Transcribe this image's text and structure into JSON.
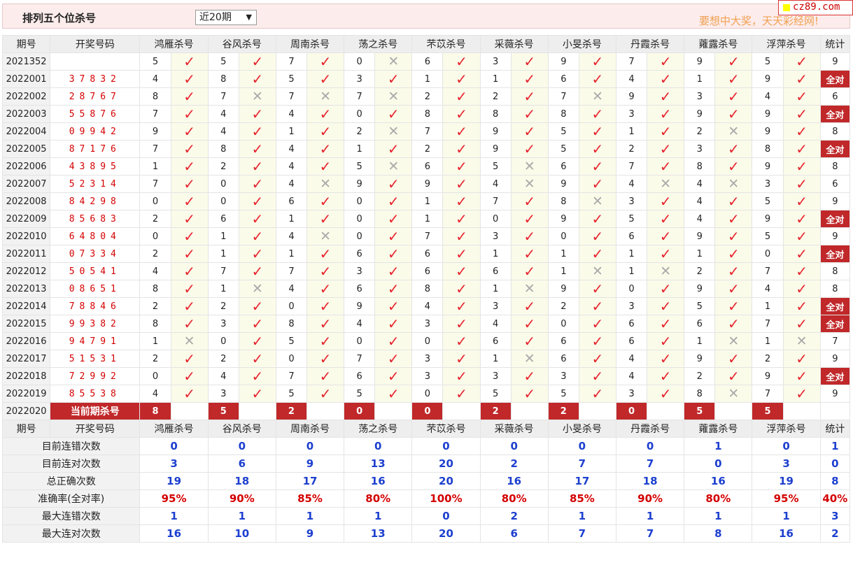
{
  "page": {
    "title": "排列五个位杀号",
    "period_selected": "近20期",
    "period_arrow": "▼",
    "slogan": "要想中大奖，天天彩经网!",
    "logo_text": "cz89.com"
  },
  "colors": {
    "accent_red": "#c0282a",
    "check_red": "#e6242d",
    "stat_blue": "#1c3fcf"
  },
  "table": {
    "headers": [
      "期号",
      "开奖号码",
      "鸿雁杀号",
      "谷风杀号",
      "周南杀号",
      "荡之杀号",
      "芣苡杀号",
      "采薇杀号",
      "小旻杀号",
      "丹霞杀号",
      "蕹露杀号",
      "浮萍杀号",
      "统计"
    ],
    "rows": [
      {
        "issue": "2021352",
        "draw": "",
        "kills": [
          5,
          5,
          7,
          0,
          6,
          3,
          9,
          7,
          9,
          5
        ],
        "marks": [
          "ok",
          "ok",
          "ok",
          "no",
          "ok",
          "ok",
          "ok",
          "ok",
          "ok",
          "ok"
        ],
        "stat": "9",
        "all": false
      },
      {
        "issue": "2022001",
        "draw": "37832",
        "kills": [
          4,
          8,
          5,
          3,
          1,
          1,
          6,
          4,
          1,
          9
        ],
        "marks": [
          "ok",
          "ok",
          "ok",
          "ok",
          "ok",
          "ok",
          "ok",
          "ok",
          "ok",
          "ok"
        ],
        "stat": "全对",
        "all": true
      },
      {
        "issue": "2022002",
        "draw": "28767",
        "kills": [
          8,
          7,
          7,
          7,
          2,
          2,
          7,
          9,
          3,
          4
        ],
        "marks": [
          "ok",
          "no",
          "no",
          "no",
          "ok",
          "ok",
          "no",
          "ok",
          "ok",
          "ok"
        ],
        "stat": "6",
        "all": false
      },
      {
        "issue": "2022003",
        "draw": "55876",
        "kills": [
          7,
          4,
          4,
          0,
          8,
          8,
          8,
          3,
          9,
          9
        ],
        "marks": [
          "ok",
          "ok",
          "ok",
          "ok",
          "ok",
          "ok",
          "ok",
          "ok",
          "ok",
          "ok"
        ],
        "stat": "全对",
        "all": true
      },
      {
        "issue": "2022004",
        "draw": "09942",
        "kills": [
          9,
          4,
          1,
          2,
          7,
          9,
          5,
          1,
          2,
          9
        ],
        "marks": [
          "ok",
          "ok",
          "ok",
          "no",
          "ok",
          "ok",
          "ok",
          "ok",
          "no",
          "ok"
        ],
        "stat": "8",
        "all": false
      },
      {
        "issue": "2022005",
        "draw": "87176",
        "kills": [
          7,
          8,
          4,
          1,
          2,
          9,
          5,
          2,
          3,
          8
        ],
        "marks": [
          "ok",
          "ok",
          "ok",
          "ok",
          "ok",
          "ok",
          "ok",
          "ok",
          "ok",
          "ok"
        ],
        "stat": "全对",
        "all": true
      },
      {
        "issue": "2022006",
        "draw": "43895",
        "kills": [
          1,
          2,
          4,
          5,
          6,
          5,
          6,
          7,
          8,
          9
        ],
        "marks": [
          "ok",
          "ok",
          "ok",
          "no",
          "ok",
          "no",
          "ok",
          "ok",
          "ok",
          "ok"
        ],
        "stat": "8",
        "all": false
      },
      {
        "issue": "2022007",
        "draw": "52314",
        "kills": [
          7,
          0,
          4,
          9,
          9,
          4,
          9,
          4,
          4,
          3
        ],
        "marks": [
          "ok",
          "ok",
          "no",
          "ok",
          "ok",
          "no",
          "ok",
          "no",
          "no",
          "ok"
        ],
        "stat": "6",
        "all": false
      },
      {
        "issue": "2022008",
        "draw": "84298",
        "kills": [
          0,
          0,
          6,
          0,
          1,
          7,
          8,
          3,
          4,
          5
        ],
        "marks": [
          "ok",
          "ok",
          "ok",
          "ok",
          "ok",
          "ok",
          "no",
          "ok",
          "ok",
          "ok"
        ],
        "stat": "9",
        "all": false
      },
      {
        "issue": "2022009",
        "draw": "85683",
        "kills": [
          2,
          6,
          1,
          0,
          1,
          0,
          9,
          5,
          4,
          9
        ],
        "marks": [
          "ok",
          "ok",
          "ok",
          "ok",
          "ok",
          "ok",
          "ok",
          "ok",
          "ok",
          "ok"
        ],
        "stat": "全对",
        "all": true
      },
      {
        "issue": "2022010",
        "draw": "64804",
        "kills": [
          0,
          1,
          4,
          0,
          7,
          3,
          0,
          6,
          9,
          5
        ],
        "marks": [
          "ok",
          "ok",
          "no",
          "ok",
          "ok",
          "ok",
          "ok",
          "ok",
          "ok",
          "ok"
        ],
        "stat": "9",
        "all": false
      },
      {
        "issue": "2022011",
        "draw": "07334",
        "kills": [
          2,
          1,
          1,
          6,
          6,
          1,
          1,
          1,
          1,
          0
        ],
        "marks": [
          "ok",
          "ok",
          "ok",
          "ok",
          "ok",
          "ok",
          "ok",
          "ok",
          "ok",
          "ok"
        ],
        "stat": "全对",
        "all": true
      },
      {
        "issue": "2022012",
        "draw": "50541",
        "kills": [
          4,
          7,
          7,
          3,
          6,
          6,
          1,
          1,
          2,
          7
        ],
        "marks": [
          "ok",
          "ok",
          "ok",
          "ok",
          "ok",
          "ok",
          "no",
          "no",
          "ok",
          "ok"
        ],
        "stat": "8",
        "all": false
      },
      {
        "issue": "2022013",
        "draw": "08651",
        "kills": [
          8,
          1,
          4,
          6,
          8,
          1,
          9,
          0,
          9,
          4
        ],
        "marks": [
          "ok",
          "no",
          "ok",
          "ok",
          "ok",
          "no",
          "ok",
          "ok",
          "ok",
          "ok"
        ],
        "stat": "8",
        "all": false
      },
      {
        "issue": "2022014",
        "draw": "78846",
        "kills": [
          2,
          2,
          0,
          9,
          4,
          3,
          2,
          3,
          5,
          1
        ],
        "marks": [
          "ok",
          "ok",
          "ok",
          "ok",
          "ok",
          "ok",
          "ok",
          "ok",
          "ok",
          "ok"
        ],
        "stat": "全对",
        "all": true
      },
      {
        "issue": "2022015",
        "draw": "99382",
        "kills": [
          8,
          3,
          8,
          4,
          3,
          4,
          0,
          6,
          6,
          7
        ],
        "marks": [
          "ok",
          "ok",
          "ok",
          "ok",
          "ok",
          "ok",
          "ok",
          "ok",
          "ok",
          "ok"
        ],
        "stat": "全对",
        "all": true
      },
      {
        "issue": "2022016",
        "draw": "94791",
        "kills": [
          1,
          0,
          5,
          0,
          0,
          6,
          6,
          6,
          1,
          1
        ],
        "marks": [
          "no",
          "ok",
          "ok",
          "ok",
          "ok",
          "ok",
          "ok",
          "ok",
          "no",
          "no"
        ],
        "stat": "7",
        "all": false
      },
      {
        "issue": "2022017",
        "draw": "51531",
        "kills": [
          2,
          2,
          0,
          7,
          3,
          1,
          6,
          4,
          9,
          2
        ],
        "marks": [
          "ok",
          "ok",
          "ok",
          "ok",
          "ok",
          "no",
          "ok",
          "ok",
          "ok",
          "ok"
        ],
        "stat": "9",
        "all": false
      },
      {
        "issue": "2022018",
        "draw": "72992",
        "kills": [
          0,
          4,
          7,
          6,
          3,
          3,
          3,
          4,
          2,
          9
        ],
        "marks": [
          "ok",
          "ok",
          "ok",
          "ok",
          "ok",
          "ok",
          "ok",
          "ok",
          "ok",
          "ok"
        ],
        "stat": "全对",
        "all": true
      },
      {
        "issue": "2022019",
        "draw": "85538",
        "kills": [
          4,
          3,
          5,
          5,
          0,
          5,
          5,
          3,
          8,
          7
        ],
        "marks": [
          "ok",
          "ok",
          "ok",
          "ok",
          "ok",
          "ok",
          "ok",
          "ok",
          "no",
          "ok"
        ],
        "stat": "9",
        "all": false
      }
    ],
    "current": {
      "issue": "2022020",
      "label": "当前期杀号",
      "kills": [
        8,
        5,
        2,
        0,
        0,
        2,
        2,
        0,
        5,
        5
      ],
      "stat": ""
    },
    "stats_headers": [
      "期号",
      "开奖号码",
      "鸿雁杀号",
      "谷风杀号",
      "周南杀号",
      "荡之杀号",
      "芣苡杀号",
      "采薇杀号",
      "小旻杀号",
      "丹霞杀号",
      "蕹露杀号",
      "浮萍杀号",
      "统计"
    ],
    "stats": [
      {
        "label": "目前连错次数",
        "values": [
          "0",
          "0",
          "0",
          "0",
          "0",
          "0",
          "0",
          "0",
          "1",
          "0",
          "1"
        ],
        "red": false
      },
      {
        "label": "目前连对次数",
        "values": [
          "3",
          "6",
          "9",
          "13",
          "20",
          "2",
          "7",
          "7",
          "0",
          "3",
          "0"
        ],
        "red": false
      },
      {
        "label": "总正确次数",
        "values": [
          "19",
          "18",
          "17",
          "16",
          "20",
          "16",
          "17",
          "18",
          "16",
          "19",
          "8"
        ],
        "red": false
      },
      {
        "label": "准确率(全对率)",
        "values": [
          "95%",
          "90%",
          "85%",
          "80%",
          "100%",
          "80%",
          "85%",
          "90%",
          "80%",
          "95%",
          "40%"
        ],
        "red": true
      },
      {
        "label": "最大连错次数",
        "values": [
          "1",
          "1",
          "1",
          "1",
          "0",
          "2",
          "1",
          "1",
          "1",
          "1",
          "3"
        ],
        "red": false
      },
      {
        "label": "最大连对次数",
        "values": [
          "16",
          "10",
          "9",
          "13",
          "20",
          "6",
          "7",
          "7",
          "8",
          "16",
          "2"
        ],
        "red": false
      }
    ],
    "mark_glyphs": {
      "ok": "✓",
      "no": "✕"
    }
  }
}
